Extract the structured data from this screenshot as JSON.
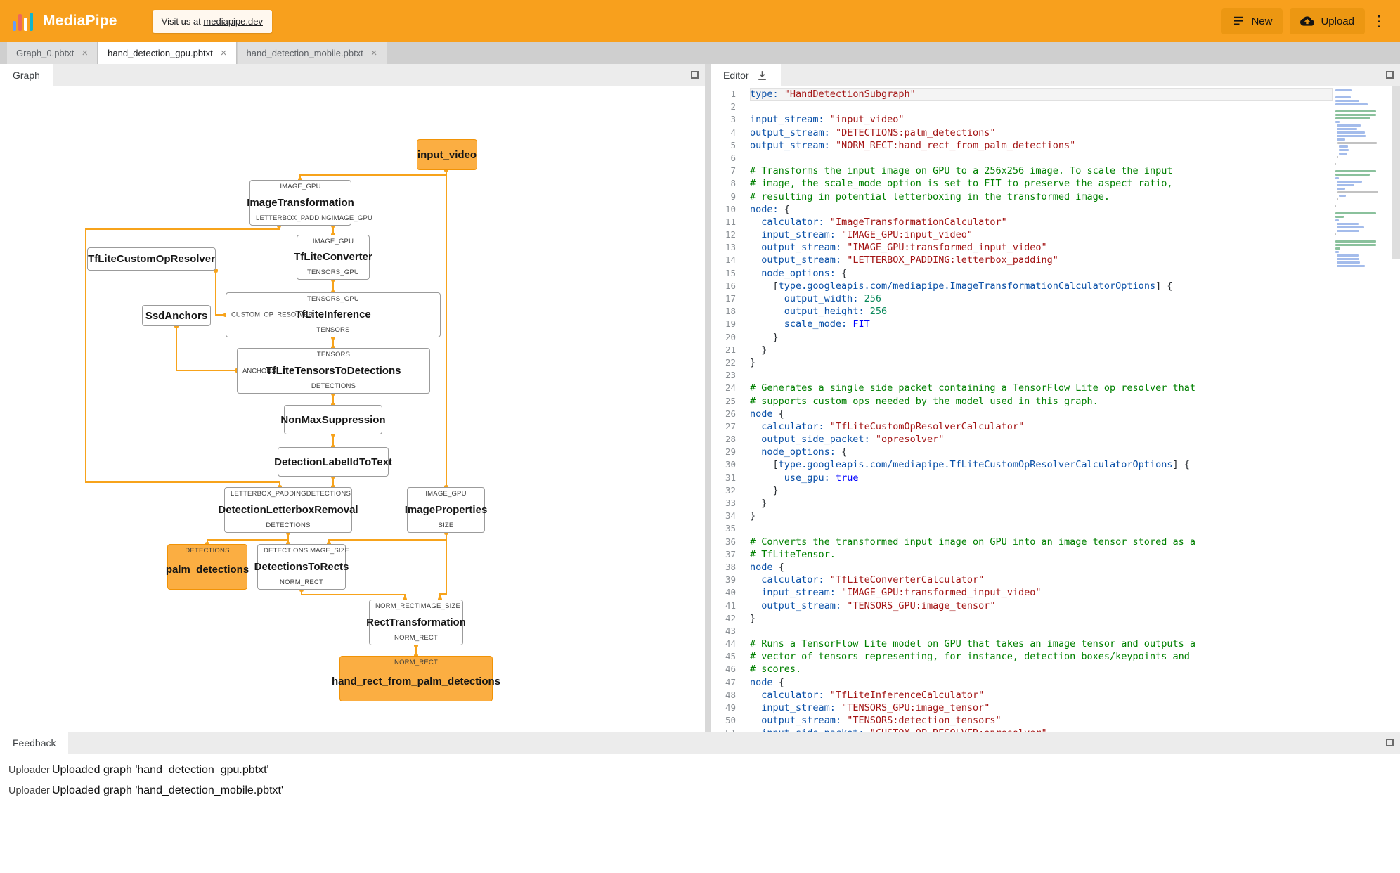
{
  "header": {
    "app_title": "MediaPipe",
    "visit_prefix": "Visit us at ",
    "visit_link": "mediapipe.dev",
    "new_button": "New",
    "upload_button": "Upload"
  },
  "icons": {
    "close_tab": "×",
    "more_menu": "⋮"
  },
  "file_tabs": [
    {
      "label": "Graph_0.pbtxt"
    },
    {
      "label": "hand_detection_gpu.pbtxt"
    },
    {
      "label": "hand_detection_mobile.pbtxt"
    }
  ],
  "graph_panel": {
    "tab_label": "Graph",
    "nodes": {
      "input_video": {
        "label": "input_video"
      },
      "image_transformation": {
        "label": "ImageTransformation",
        "port_in": "IMAGE_GPU",
        "port_out_left": "LETTERBOX_PADDING",
        "port_out_right": "IMAGE_GPU"
      },
      "tflite_custom_op_resolver": {
        "label": "TfLiteCustomOpResolver"
      },
      "tflite_converter": {
        "label": "TfLiteConverter",
        "port_in": "IMAGE_GPU",
        "port_out": "TENSORS_GPU"
      },
      "ssd_anchors": {
        "label": "SsdAnchors"
      },
      "tflite_inference": {
        "label": "TfLiteInference",
        "port_in": "TENSORS_GPU",
        "port_side": "CUSTOM_OP_RESOLVER",
        "port_out": "TENSORS"
      },
      "tflite_tensors_to_detections": {
        "label": "TfLiteTensorsToDetections",
        "port_in": "TENSORS",
        "port_side": "ANCHORS",
        "port_out": "DETECTIONS"
      },
      "non_max_suppression": {
        "label": "NonMaxSuppression"
      },
      "detection_label_id_to_text": {
        "label": "DetectionLabelIdToText"
      },
      "detection_letterbox_removal": {
        "label": "DetectionLetterboxRemoval",
        "port_in_left": "LETTERBOX_PADDING",
        "port_in_right": "DETECTIONS",
        "port_out": "DETECTIONS"
      },
      "image_properties": {
        "label": "ImageProperties",
        "port_in": "IMAGE_GPU",
        "port_out": "SIZE"
      },
      "palm_detections": {
        "label": "palm_detections",
        "port_in": "DETECTIONS"
      },
      "detections_to_rects": {
        "label": "DetectionsToRects",
        "port_in_left": "DETECTIONS",
        "port_in_right": "IMAGE_SIZE",
        "port_out": "NORM_RECT"
      },
      "rect_transformation": {
        "label": "RectTransformation",
        "port_in_left": "NORM_RECT",
        "port_in_right": "IMAGE_SIZE",
        "port_out": "NORM_RECT"
      },
      "hand_rect_from_palm_detections": {
        "label": "hand_rect_from_palm_detections",
        "port_in": "NORM_RECT"
      }
    }
  },
  "editor_panel": {
    "tab_label": "Editor",
    "lines": [
      [
        [
          "k",
          "type:"
        ],
        [
          "p",
          " "
        ],
        [
          "s",
          "\"HandDetectionSubgraph\""
        ]
      ],
      [],
      [
        [
          "k",
          "input_stream:"
        ],
        [
          "p",
          " "
        ],
        [
          "s",
          "\"input_video\""
        ]
      ],
      [
        [
          "k",
          "output_stream:"
        ],
        [
          "p",
          " "
        ],
        [
          "s",
          "\"DETECTIONS:palm_detections\""
        ]
      ],
      [
        [
          "k",
          "output_stream:"
        ],
        [
          "p",
          " "
        ],
        [
          "s",
          "\"NORM_RECT:hand_rect_from_palm_detections\""
        ]
      ],
      [],
      [
        [
          "c",
          "# Transforms the input image on GPU to a 256x256 image. To scale the input"
        ]
      ],
      [
        [
          "c",
          "# image, the scale_mode option is set to FIT to preserve the aspect ratio,"
        ]
      ],
      [
        [
          "c",
          "# resulting in potential letterboxing in the transformed image."
        ]
      ],
      [
        [
          "k",
          "node:"
        ],
        [
          "p",
          " {"
        ]
      ],
      [
        [
          "p",
          "  "
        ],
        [
          "k",
          "calculator:"
        ],
        [
          "p",
          " "
        ],
        [
          "s",
          "\"ImageTransformationCalculator\""
        ]
      ],
      [
        [
          "p",
          "  "
        ],
        [
          "k",
          "input_stream:"
        ],
        [
          "p",
          " "
        ],
        [
          "s",
          "\"IMAGE_GPU:input_video\""
        ]
      ],
      [
        [
          "p",
          "  "
        ],
        [
          "k",
          "output_stream:"
        ],
        [
          "p",
          " "
        ],
        [
          "s",
          "\"IMAGE_GPU:transformed_input_video\""
        ]
      ],
      [
        [
          "p",
          "  "
        ],
        [
          "k",
          "output_stream:"
        ],
        [
          "p",
          " "
        ],
        [
          "s",
          "\"LETTERBOX_PADDING:letterbox_padding\""
        ]
      ],
      [
        [
          "p",
          "  "
        ],
        [
          "k",
          "node_options:"
        ],
        [
          "p",
          " {"
        ]
      ],
      [
        [
          "p",
          "    ["
        ],
        [
          "k",
          "type.googleapis.com/mediapipe.ImageTransformationCalculatorOptions"
        ],
        [
          "p",
          "] {"
        ]
      ],
      [
        [
          "p",
          "      "
        ],
        [
          "k",
          "output_width:"
        ],
        [
          "p",
          " "
        ],
        [
          "n",
          "256"
        ]
      ],
      [
        [
          "p",
          "      "
        ],
        [
          "k",
          "output_height:"
        ],
        [
          "p",
          " "
        ],
        [
          "n",
          "256"
        ]
      ],
      [
        [
          "p",
          "      "
        ],
        [
          "k",
          "scale_mode:"
        ],
        [
          "p",
          " "
        ],
        [
          "e",
          "FIT"
        ]
      ],
      [
        [
          "p",
          "    }"
        ]
      ],
      [
        [
          "p",
          "  }"
        ]
      ],
      [
        [
          "p",
          "}"
        ]
      ],
      [],
      [
        [
          "c",
          "# Generates a single side packet containing a TensorFlow Lite op resolver that"
        ]
      ],
      [
        [
          "c",
          "# supports custom ops needed by the model used in this graph."
        ]
      ],
      [
        [
          "k",
          "node"
        ],
        [
          "p",
          " {"
        ]
      ],
      [
        [
          "p",
          "  "
        ],
        [
          "k",
          "calculator:"
        ],
        [
          "p",
          " "
        ],
        [
          "s",
          "\"TfLiteCustomOpResolverCalculator\""
        ]
      ],
      [
        [
          "p",
          "  "
        ],
        [
          "k",
          "output_side_packet:"
        ],
        [
          "p",
          " "
        ],
        [
          "s",
          "\"opresolver\""
        ]
      ],
      [
        [
          "p",
          "  "
        ],
        [
          "k",
          "node_options:"
        ],
        [
          "p",
          " {"
        ]
      ],
      [
        [
          "p",
          "    ["
        ],
        [
          "k",
          "type.googleapis.com/mediapipe.TfLiteCustomOpResolverCalculatorOptions"
        ],
        [
          "p",
          "] {"
        ]
      ],
      [
        [
          "p",
          "      "
        ],
        [
          "k",
          "use_gpu:"
        ],
        [
          "p",
          " "
        ],
        [
          "e",
          "true"
        ]
      ],
      [
        [
          "p",
          "    }"
        ]
      ],
      [
        [
          "p",
          "  }"
        ]
      ],
      [
        [
          "p",
          "}"
        ]
      ],
      [],
      [
        [
          "c",
          "# Converts the transformed input image on GPU into an image tensor stored as a"
        ]
      ],
      [
        [
          "c",
          "# TfLiteTensor."
        ]
      ],
      [
        [
          "k",
          "node"
        ],
        [
          "p",
          " {"
        ]
      ],
      [
        [
          "p",
          "  "
        ],
        [
          "k",
          "calculator:"
        ],
        [
          "p",
          " "
        ],
        [
          "s",
          "\"TfLiteConverterCalculator\""
        ]
      ],
      [
        [
          "p",
          "  "
        ],
        [
          "k",
          "input_stream:"
        ],
        [
          "p",
          " "
        ],
        [
          "s",
          "\"IMAGE_GPU:transformed_input_video\""
        ]
      ],
      [
        [
          "p",
          "  "
        ],
        [
          "k",
          "output_stream:"
        ],
        [
          "p",
          " "
        ],
        [
          "s",
          "\"TENSORS_GPU:image_tensor\""
        ]
      ],
      [
        [
          "p",
          "}"
        ]
      ],
      [],
      [
        [
          "c",
          "# Runs a TensorFlow Lite model on GPU that takes an image tensor and outputs a"
        ]
      ],
      [
        [
          "c",
          "# vector of tensors representing, for instance, detection boxes/keypoints and"
        ]
      ],
      [
        [
          "c",
          "# scores."
        ]
      ],
      [
        [
          "k",
          "node"
        ],
        [
          "p",
          " {"
        ]
      ],
      [
        [
          "p",
          "  "
        ],
        [
          "k",
          "calculator:"
        ],
        [
          "p",
          " "
        ],
        [
          "s",
          "\"TfLiteInferenceCalculator\""
        ]
      ],
      [
        [
          "p",
          "  "
        ],
        [
          "k",
          "input_stream:"
        ],
        [
          "p",
          " "
        ],
        [
          "s",
          "\"TENSORS_GPU:image_tensor\""
        ]
      ],
      [
        [
          "p",
          "  "
        ],
        [
          "k",
          "output_stream:"
        ],
        [
          "p",
          " "
        ],
        [
          "s",
          "\"TENSORS:detection_tensors\""
        ]
      ],
      [
        [
          "p",
          "  "
        ],
        [
          "k",
          "input_side_packet:"
        ],
        [
          "p",
          " "
        ],
        [
          "s",
          "\"CUSTOM_OP_RESOLVER:opresolver\""
        ]
      ]
    ]
  },
  "feedback_panel": {
    "tab_label": "Feedback",
    "entries": [
      {
        "source": "Uploader",
        "message": "Uploaded graph 'hand_detection_gpu.pbtxt'"
      },
      {
        "source": "Uploader",
        "message": "Uploaded graph 'hand_detection_mobile.pbtxt'"
      }
    ]
  },
  "colors": {
    "header_bg": "#F8A01D",
    "edge_orange": "#F7A31B",
    "io_node_fill": "#FBAE42",
    "io_node_border": "#F19306",
    "comment_green": "#008000",
    "key_blue": "#0B51A8",
    "string_red": "#A31515",
    "keyword_blue": "#0000FF",
    "number_green": "#09885A"
  }
}
